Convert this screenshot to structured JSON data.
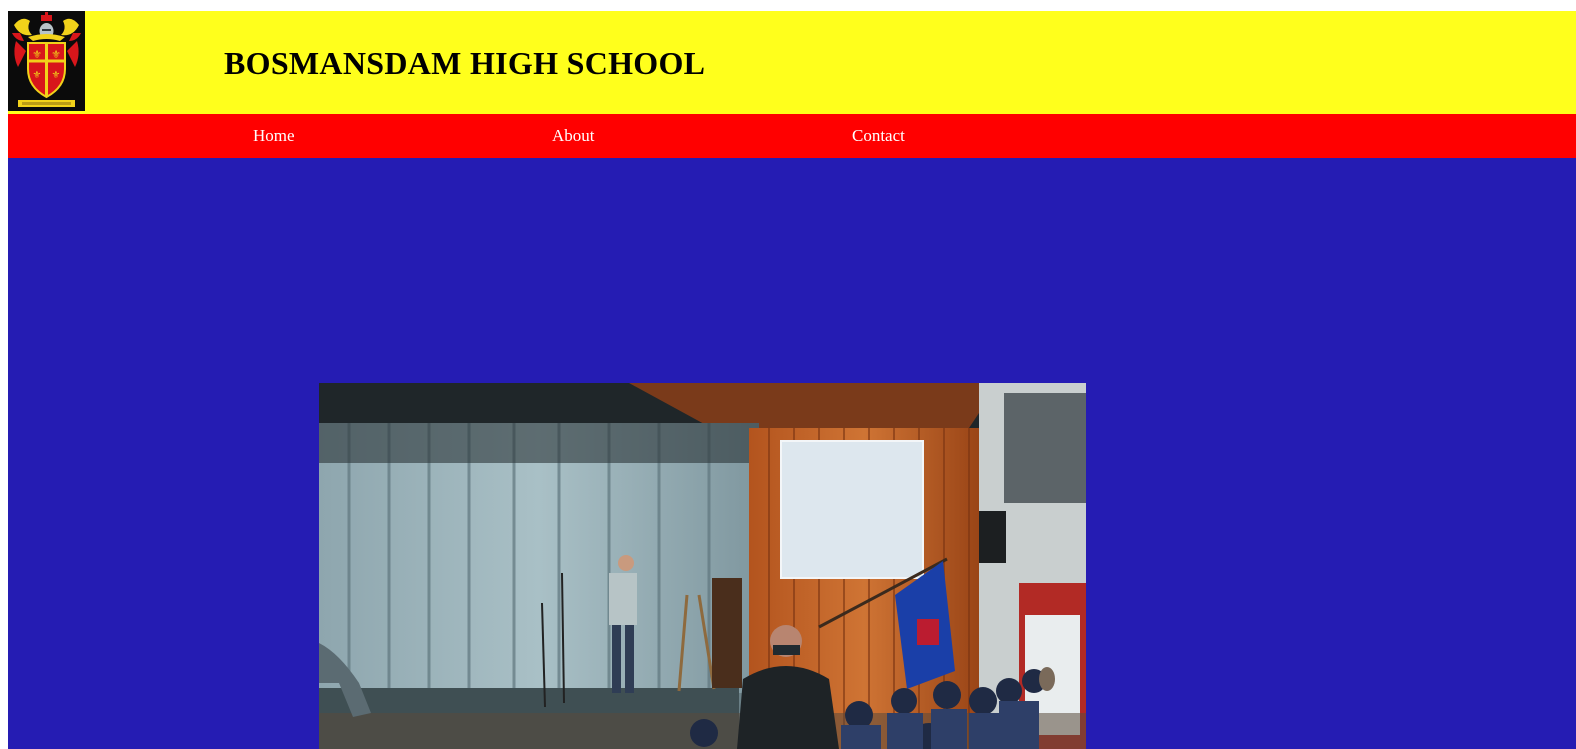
{
  "header": {
    "title": "BOSMANSDAM HIGH SCHOOL",
    "logo_icon": "school-crest-icon"
  },
  "nav": {
    "items": [
      {
        "label": "Home"
      },
      {
        "label": "About"
      },
      {
        "label": "Contact"
      }
    ]
  },
  "main": {
    "photo_icon": "school-hall-assembly-photo"
  },
  "colors": {
    "header_bg": "#ffff1c",
    "nav_bg": "#ff0000",
    "main_bg": "#251cb3",
    "nav_text": "#ffffff"
  }
}
